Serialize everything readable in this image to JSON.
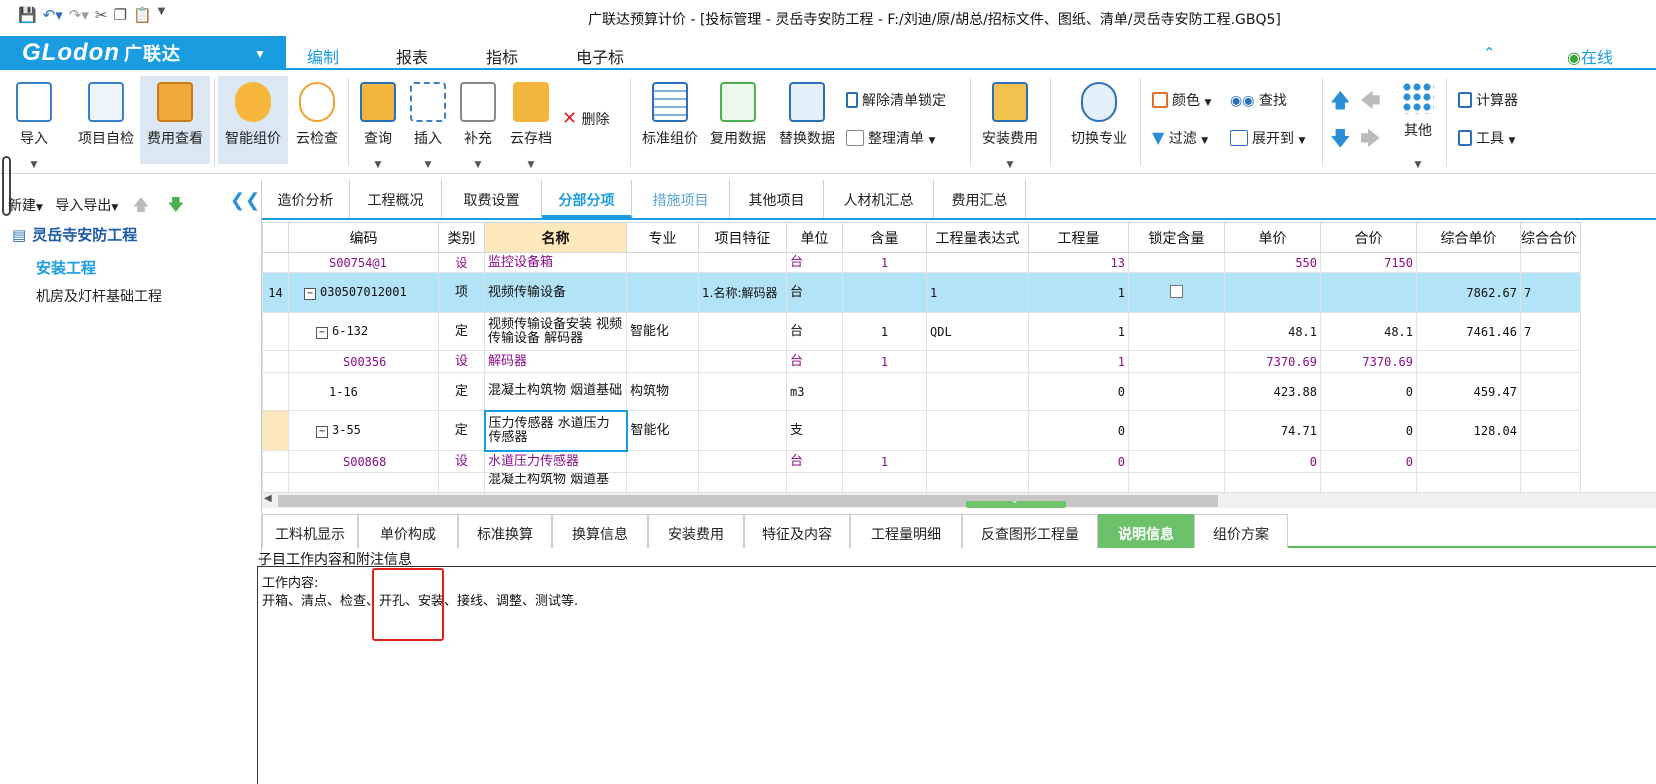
{
  "window": {
    "title": "广联达预算计价 - [投标管理 - 灵岳寺安防工程 - F:/刘迪/原/胡总/招标文件、图纸、清单/灵岳寺安防工程.GBQ5]"
  },
  "brand": {
    "logo": "GLodon",
    "cn": "广联达"
  },
  "menu": {
    "tabs": [
      "编制",
      "报表",
      "指标",
      "电子标"
    ],
    "online": "在线"
  },
  "ribbon": {
    "import": "导入",
    "self_check": "项目自检",
    "fee_view": "费用查看",
    "smart_price": "智能组价",
    "cloud_check": "云检查",
    "query": "查询",
    "insert": "插入",
    "supplement": "补充",
    "cloud_save": "云存档",
    "delete": "删除",
    "standard_price": "标准组价",
    "reuse_data": "复用数据",
    "replace_data": "替换数据",
    "unlock_list": "解除清单锁定",
    "organize_list": "整理清单",
    "install_fee": "安装费用",
    "switch_major": "切换专业",
    "color": "颜色",
    "find": "查找",
    "filter": "过滤",
    "expand_to": "展开到",
    "other": "其他",
    "calculator": "计算器",
    "tools": "工具"
  },
  "left": {
    "new": "新建",
    "import_export": "导入导出",
    "project": "灵岳寺安防工程",
    "items": [
      "安装工程",
      "机房及灯杆基础工程"
    ]
  },
  "subtabs": [
    "造价分析",
    "工程概况",
    "取费设置",
    "分部分项",
    "措施项目",
    "其他项目",
    "人材机汇总",
    "费用汇总"
  ],
  "table": {
    "headers": [
      "编码",
      "类别",
      "名称",
      "专业",
      "项目特征",
      "单位",
      "含量",
      "工程量表达式",
      "工程量",
      "锁定含量",
      "单价",
      "合价",
      "综合单价",
      "综合合价"
    ],
    "rows": [
      {
        "no": "",
        "code": "S00754@1",
        "type": "设",
        "name": "监控设备箱",
        "major": "",
        "feature": "",
        "unit": "台",
        "content": "1",
        "expr": "",
        "qty": "13",
        "price": "550",
        "total": "7150",
        "uprice": "",
        "utotal": ""
      },
      {
        "no": "14",
        "code": "030507012001",
        "type": "项",
        "name": "视频传输设备",
        "major": "",
        "feature": "1.名称:解码器",
        "unit": "台",
        "content": "",
        "expr": "1",
        "qty": "1",
        "price": "",
        "total": "",
        "uprice": "7862.67",
        "utotal": "7"
      },
      {
        "no": "",
        "code": "6-132",
        "type": "定",
        "name": "视频传输设备安装 视频传输设备 解码器",
        "major": "智能化",
        "feature": "",
        "unit": "台",
        "content": "1",
        "expr": "QDL",
        "qty": "1",
        "price": "48.1",
        "total": "48.1",
        "uprice": "7461.46",
        "utotal": "7"
      },
      {
        "no": "",
        "code": "S00356",
        "type": "设",
        "name": "解码器",
        "major": "",
        "feature": "",
        "unit": "台",
        "content": "1",
        "expr": "",
        "qty": "1",
        "price": "7370.69",
        "total": "7370.69",
        "uprice": "",
        "utotal": ""
      },
      {
        "no": "",
        "code": "1-16",
        "type": "定",
        "name": "混凝土构筑物 烟道基础",
        "major": "构筑物",
        "feature": "",
        "unit": "m3",
        "content": "",
        "expr": "",
        "qty": "0",
        "price": "423.88",
        "total": "0",
        "uprice": "459.47",
        "utotal": ""
      },
      {
        "no": "",
        "code": "3-55",
        "type": "定",
        "name": "压力传感器 水道压力传感器",
        "major": "智能化",
        "feature": "",
        "unit": "支",
        "content": "",
        "expr": "",
        "qty": "0",
        "price": "74.71",
        "total": "0",
        "uprice": "128.04",
        "utotal": ""
      },
      {
        "no": "",
        "code": "S00868",
        "type": "设",
        "name": "水道压力传感器",
        "major": "",
        "feature": "",
        "unit": "台",
        "content": "1",
        "expr": "",
        "qty": "0",
        "price": "0",
        "total": "0",
        "uprice": "",
        "utotal": ""
      },
      {
        "no": "",
        "code": "",
        "type": "",
        "name": "混凝土构筑物 烟道基",
        "major": "",
        "feature": "",
        "unit": "",
        "content": "",
        "expr": "",
        "qty": "",
        "price": "",
        "total": "",
        "uprice": "",
        "utotal": ""
      }
    ]
  },
  "bottom_tabs": [
    "工料机显示",
    "单价构成",
    "标准换算",
    "换算信息",
    "安装费用",
    "特征及内容",
    "工程量明细",
    "反查图形工程量",
    "说明信息",
    "组价方案"
  ],
  "info": {
    "header": "子目工作内容和附注信息",
    "line1": "工作内容:",
    "line2": "开箱、清点、检查、开孔、安装、接线、调整、测试等."
  },
  "colors": {
    "accent": "#1a9ce0",
    "green_tab": "#6cc16a",
    "highlight": "#e0201a",
    "sub_row": "#8a0e8a"
  }
}
